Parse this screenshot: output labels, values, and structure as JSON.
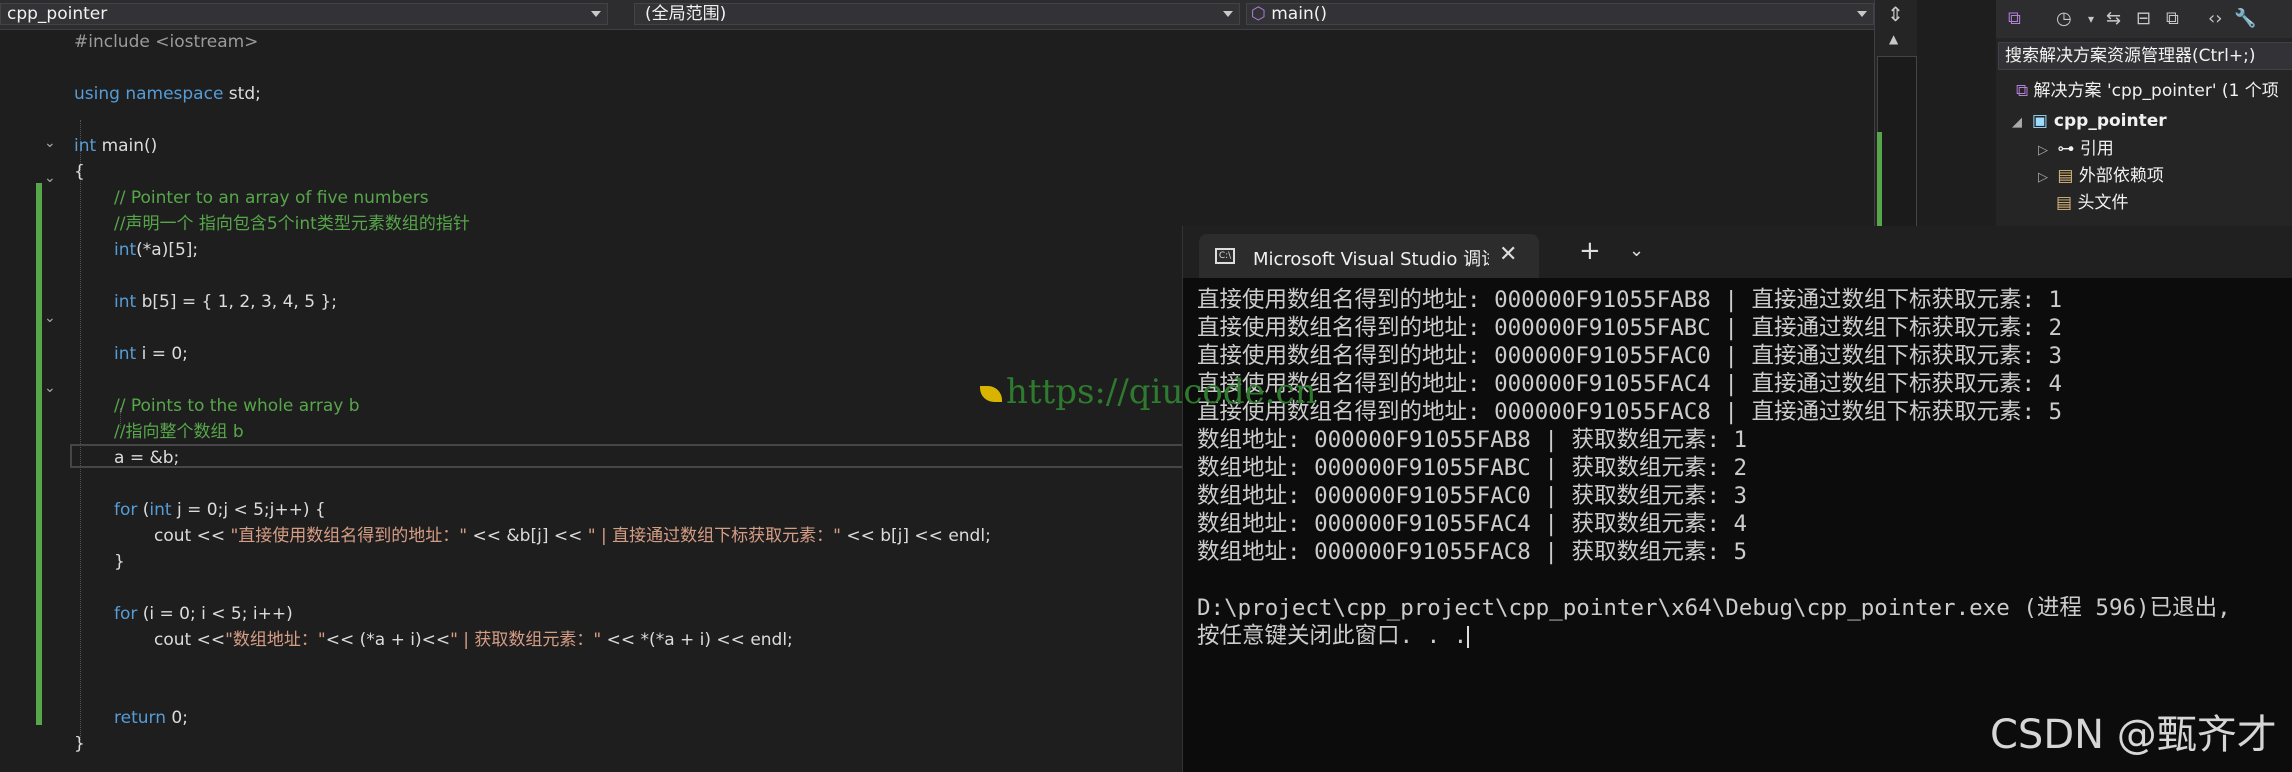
{
  "navbar": {
    "project": "cpp_pointer",
    "scope": "(全局范围)",
    "function": "main()"
  },
  "code": {
    "l1": "#include <iostream>",
    "l3_kw": "using namespace",
    "l3_rest": " std;",
    "l5_kw": "int",
    "l5_rest": " main()",
    "l6": "{",
    "l7": "// Pointer to an array of five numbers",
    "l8": "//声明一个 指向包含5个int类型元素数组的指针",
    "l9_kw": "int",
    "l9_rest": "(*a)[5];",
    "l11_kw": "int",
    "l11_rest": " b[5] = { 1, 2, 3, 4, 5 };",
    "l13_kw": "int",
    "l13_rest": " i = 0;",
    "l15": "// Points to the whole array b",
    "l16": "//指向整个数组 b",
    "l17": "a = &b;",
    "l19_kw1": "for",
    "l19_mid": " (",
    "l19_kw2": "int",
    "l19_rest": " j = 0;j < 5;j++) {",
    "l20_a": "cout << ",
    "l20_s1": "\"直接使用数组名得到的地址：\"",
    "l20_b": " << &b[j] << ",
    "l20_s2": "\" | 直接通过数组下标获取元素：\"",
    "l20_c": " << b[j] << endl;",
    "l21": "}",
    "l23_kw": "for",
    "l23_rest": " (i = 0; i < 5; i++)",
    "l24_a": "cout <<",
    "l24_s1": "\"数组地址：\"",
    "l24_b": "<< (*a + i)<<",
    "l24_s2": "\" | 获取数组元素：\"",
    "l24_c": " << *(*a + i) << endl;",
    "l27_kw": "return",
    "l27_rest": " 0;",
    "l28": "}"
  },
  "solution_explorer": {
    "search_placeholder": "搜索解决方案资源管理器(Ctrl+;)",
    "solution": "解决方案 'cpp_pointer' (1 个项",
    "project": "cpp_pointer",
    "references": "引用",
    "external_deps": "外部依赖项",
    "headers": "头文件"
  },
  "console": {
    "tab_title": "Microsoft Visual Studio 调试控制台",
    "lines": [
      "直接使用数组名得到的地址: 000000F91055FAB8 | 直接通过数组下标获取元素: 1",
      "直接使用数组名得到的地址: 000000F91055FABC | 直接通过数组下标获取元素: 2",
      "直接使用数组名得到的地址: 000000F91055FAC0 | 直接通过数组下标获取元素: 3",
      "直接使用数组名得到的地址: 000000F91055FAC4 | 直接通过数组下标获取元素: 4",
      "直接使用数组名得到的地址: 000000F91055FAC8 | 直接通过数组下标获取元素: 5",
      "数组地址: 000000F91055FAB8 | 获取数组元素: 1",
      "数组地址: 000000F91055FABC | 获取数组元素: 2",
      "数组地址: 000000F91055FAC0 | 获取数组元素: 3",
      "数组地址: 000000F91055FAC4 | 获取数组元素: 4",
      "数组地址: 000000F91055FAC8 | 获取数组元素: 5",
      "",
      "D:\\project\\cpp_project\\cpp_pointer\\x64\\Debug\\cpp_pointer.exe (进程 596)已退出,",
      "按任意键关闭此窗口. . ."
    ]
  },
  "watermark": "https://qiucode.cn",
  "csdn_mark": "CSDN @甄齐才"
}
